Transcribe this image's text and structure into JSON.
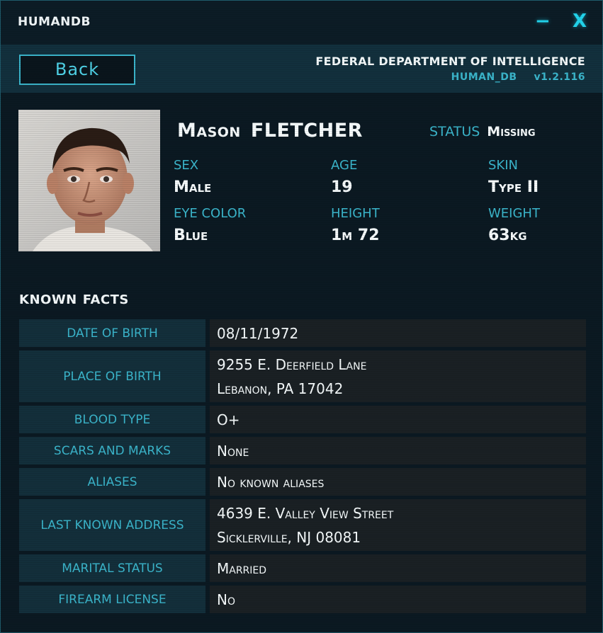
{
  "window": {
    "title": "HUMANDB",
    "minimize_glyph": "−",
    "close_glyph": "X"
  },
  "header": {
    "back_label": "Back",
    "agency": "FEDERAL DEPARTMENT OF INTELLIGENCE",
    "db_name": "HUMAN_DB",
    "version": "v1.2.116"
  },
  "profile": {
    "first_name": "Mason",
    "last_name": "FLETCHER",
    "status_label": "STATUS",
    "status_value": "Missing",
    "attributes": [
      {
        "label": "SEX",
        "value": "Male"
      },
      {
        "label": "AGE",
        "value": "19"
      },
      {
        "label": "SKIN",
        "value": "Type II"
      },
      {
        "label": "EYE COLOR",
        "value": "Blue"
      },
      {
        "label": "HEIGHT",
        "value": "1m 72"
      },
      {
        "label": "WEIGHT",
        "value": "63kg"
      }
    ]
  },
  "facts": {
    "title_1": "KNOWN",
    "title_2": "FACTS",
    "rows": [
      {
        "label": "DATE OF BIRTH",
        "line1": "08/11/1972",
        "line2": ""
      },
      {
        "label": "PLACE OF BIRTH",
        "line1": "9255 E. Deerfield Lane",
        "line2": "Lebanon, PA 17042"
      },
      {
        "label": "BLOOD TYPE",
        "line1": "O+",
        "line2": ""
      },
      {
        "label": "SCARS AND MARKS",
        "line1": "None",
        "line2": ""
      },
      {
        "label": "ALIASES",
        "line1": "No known aliases",
        "line2": ""
      },
      {
        "label": "LAST KNOWN ADDRESS",
        "line1": "4639 E. Valley View Street",
        "line2": "Sicklerville, NJ 08081"
      },
      {
        "label": "MARITAL STATUS",
        "line1": "Married",
        "line2": ""
      },
      {
        "label": "FIREARM LICENSE",
        "line1": "No",
        "line2": ""
      }
    ]
  },
  "colors": {
    "accent": "#3bb6cc",
    "cyan": "#22d6ee",
    "text": "#f6fbfc"
  }
}
